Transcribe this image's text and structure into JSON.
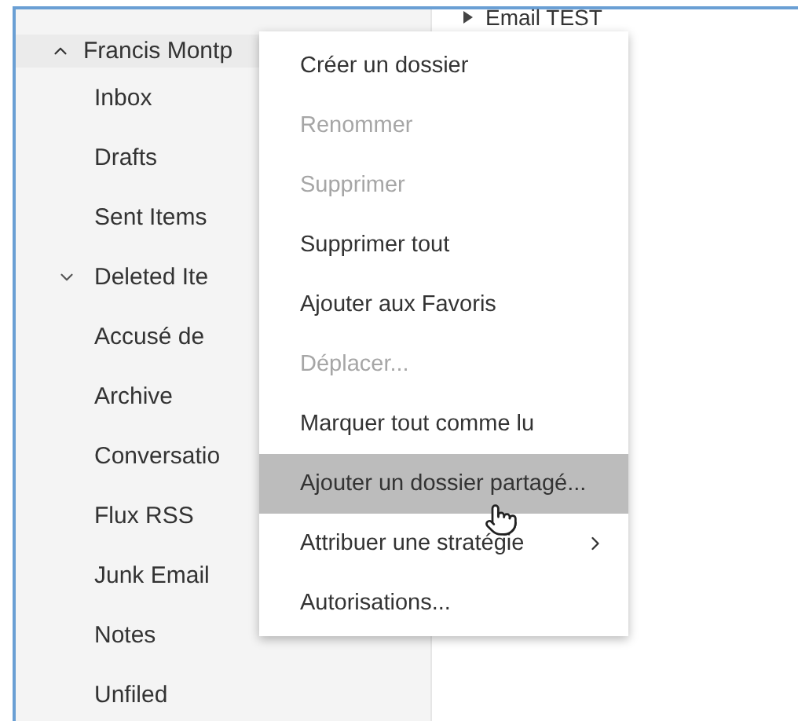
{
  "folder_tree": {
    "account": {
      "label": "Francis Montp",
      "expanded": true
    },
    "items": [
      {
        "label": "Inbox"
      },
      {
        "label": "Drafts"
      },
      {
        "label": "Sent Items"
      },
      {
        "label": "Deleted Ite",
        "expanded": true
      },
      {
        "label": "Accusé de"
      },
      {
        "label": "Archive"
      },
      {
        "label": "Conversatio"
      },
      {
        "label": "Flux RSS"
      },
      {
        "label": "Junk Email"
      },
      {
        "label": "Notes"
      },
      {
        "label": "Unfiled"
      }
    ]
  },
  "right_pane": {
    "items": [
      {
        "label": "Email TEST",
        "expanded": false
      }
    ]
  },
  "context_menu": {
    "items": [
      {
        "label": "Créer un dossier",
        "disabled": false,
        "selected": false,
        "submenu": false
      },
      {
        "label": "Renommer",
        "disabled": true,
        "selected": false,
        "submenu": false
      },
      {
        "label": "Supprimer",
        "disabled": true,
        "selected": false,
        "submenu": false
      },
      {
        "label": "Supprimer tout",
        "disabled": false,
        "selected": false,
        "submenu": false
      },
      {
        "label": "Ajouter aux Favoris",
        "disabled": false,
        "selected": false,
        "submenu": false
      },
      {
        "label": "Déplacer...",
        "disabled": true,
        "selected": false,
        "submenu": false
      },
      {
        "label": "Marquer tout comme lu",
        "disabled": false,
        "selected": false,
        "submenu": false
      },
      {
        "label": "Ajouter un dossier partagé...",
        "disabled": false,
        "selected": true,
        "submenu": false
      },
      {
        "label": "Attribuer une stratégie",
        "disabled": false,
        "selected": false,
        "submenu": true
      },
      {
        "label": "Autorisations...",
        "disabled": false,
        "selected": false,
        "submenu": false
      }
    ]
  }
}
